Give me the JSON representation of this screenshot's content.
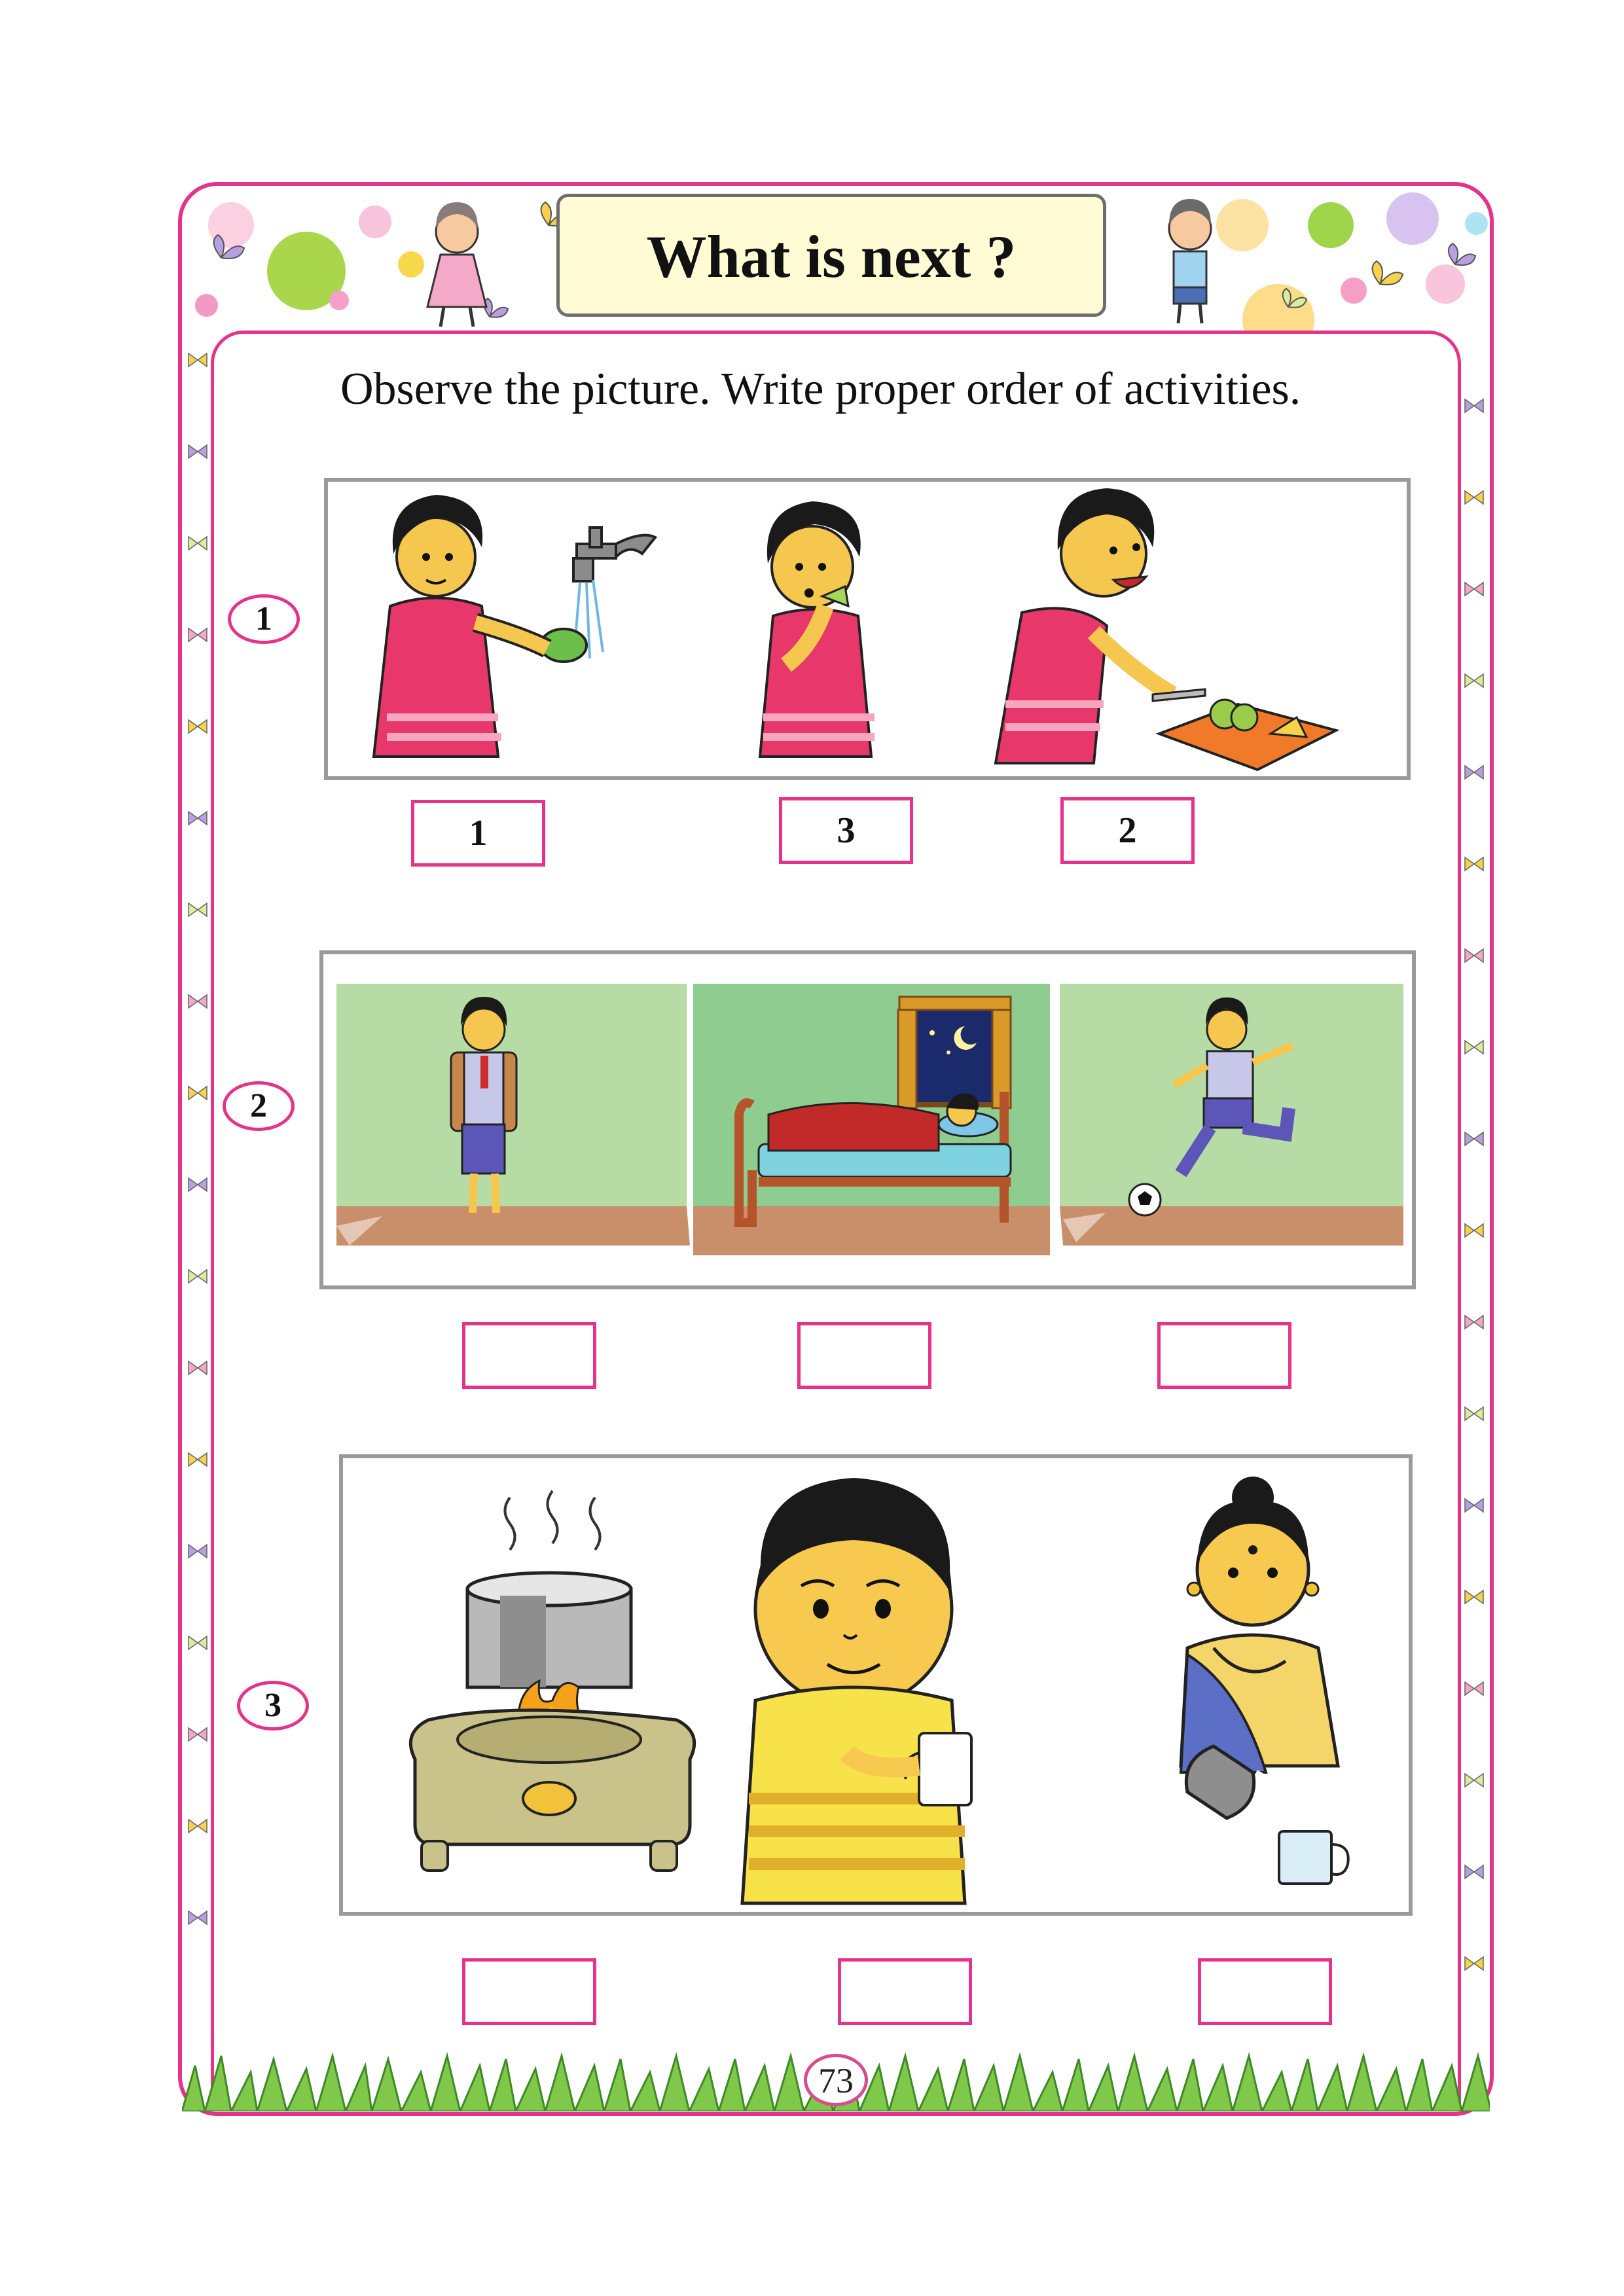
{
  "title": "What is next ?",
  "instruction": "Observe the picture. Write proper order of activities.",
  "questions": [
    {
      "number": "1",
      "answers": [
        "1",
        "3",
        "2"
      ]
    },
    {
      "number": "2",
      "answers": [
        "",
        "",
        ""
      ]
    },
    {
      "number": "3",
      "answers": [
        "",
        "",
        ""
      ]
    }
  ],
  "page_number": "73",
  "colors": {
    "accent": "#e6338a",
    "panel_border": "#9a9a9a",
    "banner": "#fffbd5",
    "wall_green": "#b6dba5",
    "floor_brown": "#c98f6b"
  }
}
